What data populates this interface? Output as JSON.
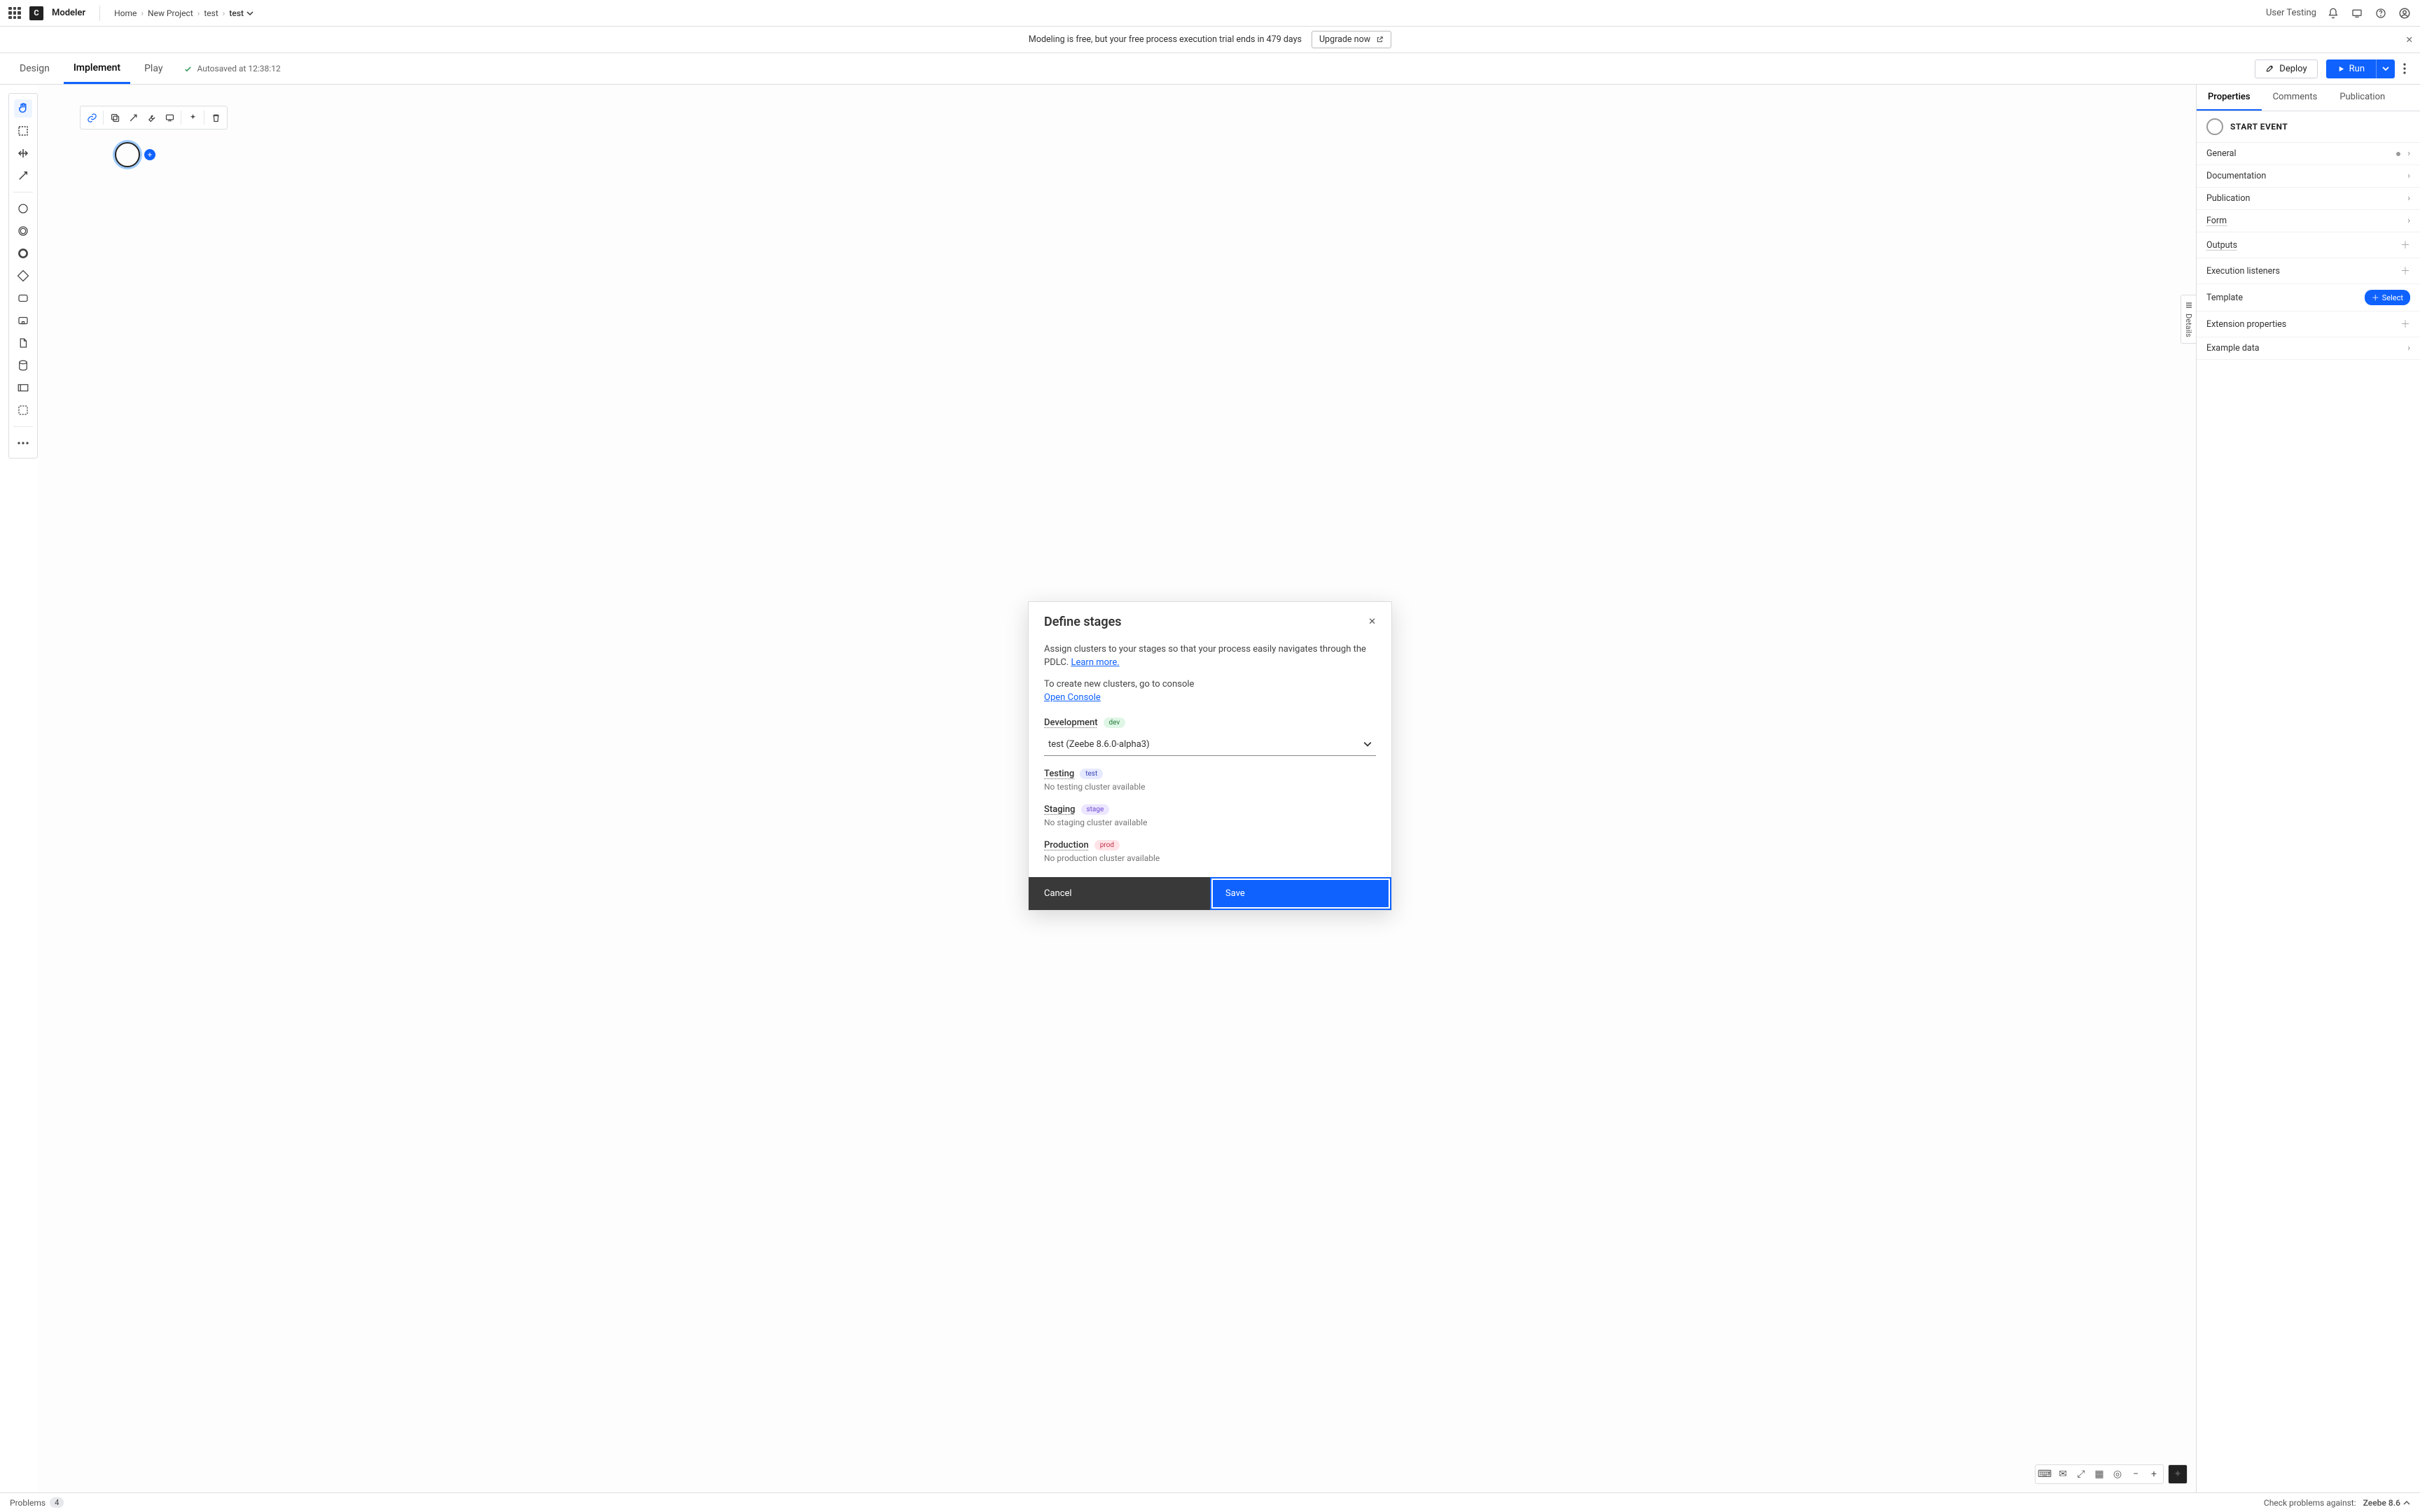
{
  "header": {
    "brand": "Modeler",
    "logo_letter": "C",
    "user_testing": "User Testing",
    "breadcrumbs": [
      "Home",
      "New Project",
      "test",
      "test"
    ]
  },
  "banner": {
    "text": "Modeling is free, but your free process execution trial ends in 479 days",
    "upgrade_label": "Upgrade now"
  },
  "modes": {
    "tabs": [
      "Design",
      "Implement",
      "Play"
    ],
    "active": "Implement",
    "autosaved": "Autosaved at 12:38:12",
    "deploy": "Deploy",
    "run": "Run"
  },
  "right_panel": {
    "tabs": [
      "Properties",
      "Comments",
      "Publication"
    ],
    "active": "Properties",
    "title": "START EVENT",
    "rows": [
      {
        "label": "General",
        "kind": "dot-chevron"
      },
      {
        "label": "Documentation",
        "kind": "chevron"
      },
      {
        "label": "Publication",
        "kind": "chevron"
      },
      {
        "label": "Form",
        "kind": "chevron",
        "underline": true
      },
      {
        "label": "Outputs",
        "kind": "plus",
        "underline": true
      },
      {
        "label": "Execution listeners",
        "kind": "plus"
      },
      {
        "label": "Template",
        "kind": "select"
      },
      {
        "label": "Extension properties",
        "kind": "plus"
      },
      {
        "label": "Example data",
        "kind": "chevron"
      }
    ],
    "select_label": "Select"
  },
  "details_tab": "Details",
  "modal": {
    "title": "Define stages",
    "intro_a": "Assign clusters to your stages so that your process easily navigates through the PDLC.",
    "learn_more": "Learn more.",
    "intro_b": "To create new clusters, go to console",
    "open_console": "Open Console",
    "stages": [
      {
        "name": "Development",
        "tag": "dev",
        "tag_class": "dev",
        "selected": "test (Zeebe 8.6.0-alpha3)",
        "note": ""
      },
      {
        "name": "Testing",
        "tag": "test",
        "tag_class": "test",
        "selected": "",
        "note": "No testing cluster available"
      },
      {
        "name": "Staging",
        "tag": "stage",
        "tag_class": "stage",
        "selected": "",
        "note": "No staging cluster available"
      },
      {
        "name": "Production",
        "tag": "prod",
        "tag_class": "prod",
        "selected": "",
        "note": "No production cluster available"
      }
    ],
    "cancel": "Cancel",
    "save": "Save"
  },
  "bottom": {
    "problems_label": "Problems",
    "problems_count": "4",
    "check_label": "Check problems against:",
    "engine": "Zeebe 8.6"
  }
}
